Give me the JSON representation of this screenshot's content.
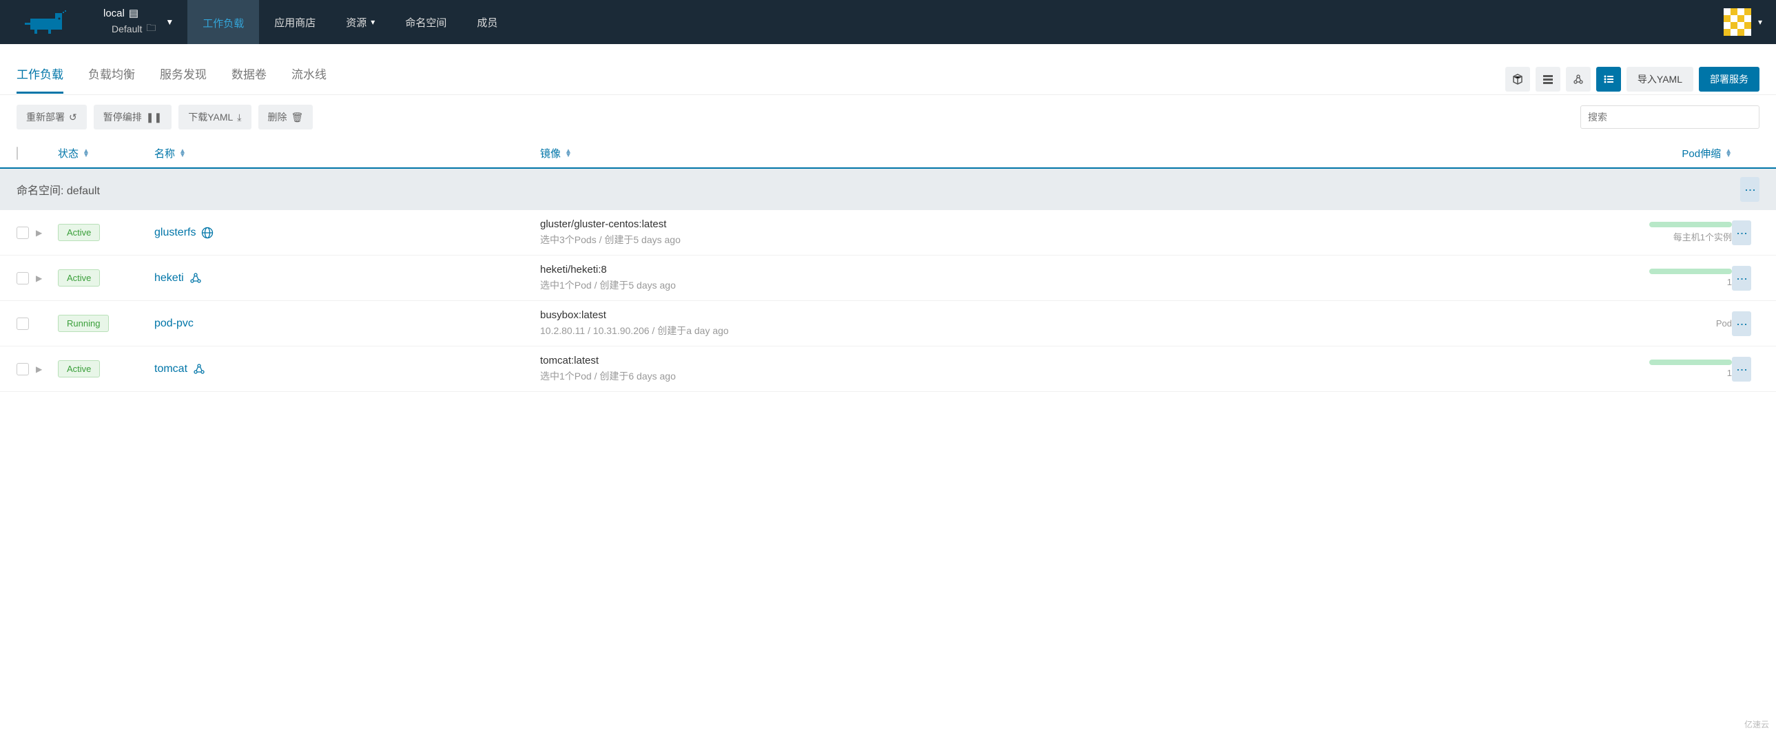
{
  "header": {
    "cluster_name": "local",
    "project_name": "Default"
  },
  "nav": {
    "workloads": "工作负载",
    "apps": "应用商店",
    "resources": "资源",
    "namespaces": "命名空间",
    "members": "成员"
  },
  "subtabs": {
    "workloads": "工作负载",
    "load_balancing": "负载均衡",
    "service_discovery": "服务发现",
    "volumes": "数据卷",
    "pipelines": "流水线"
  },
  "buttons": {
    "import_yaml": "导入YAML",
    "deploy": "部署服务"
  },
  "actions": {
    "redeploy": "重新部署",
    "pause": "暂停编排",
    "download_yaml": "下载YAML",
    "delete": "删除"
  },
  "search": {
    "placeholder": "搜索"
  },
  "columns": {
    "status": "状态",
    "name": "名称",
    "image": "镜像",
    "pod_scale": "Pod伸缩"
  },
  "group": {
    "namespace_label": "命名空间: default"
  },
  "rows": [
    {
      "status": "Active",
      "status_class": "badge-active",
      "expandable": true,
      "name": "glusterfs",
      "type_icon": "globe-icon",
      "image": "gluster/gluster-centos:latest",
      "sub": "选中3个Pods / 创建于5 days ago",
      "scale_type": "bar",
      "scale_text": "每主机1个实例"
    },
    {
      "status": "Active",
      "status_class": "badge-active",
      "expandable": true,
      "name": "heketi",
      "type_icon": "cube-icon",
      "image": "heketi/heketi:8",
      "sub": "选中1个Pod / 创建于5 days ago",
      "scale_type": "bar",
      "scale_text": "1"
    },
    {
      "status": "Running",
      "status_class": "badge-running",
      "expandable": false,
      "name": "pod-pvc",
      "type_icon": "",
      "image": "busybox:latest",
      "sub": "10.2.80.11 / 10.31.90.206 / 创建于a day ago",
      "scale_type": "text",
      "scale_text": "Pod"
    },
    {
      "status": "Active",
      "status_class": "badge-active",
      "expandable": true,
      "name": "tomcat",
      "type_icon": "cube-icon",
      "image": "tomcat:latest",
      "sub": "选中1个Pod / 创建于6 days ago",
      "scale_type": "bar",
      "scale_text": "1"
    }
  ],
  "watermark": "亿速云"
}
